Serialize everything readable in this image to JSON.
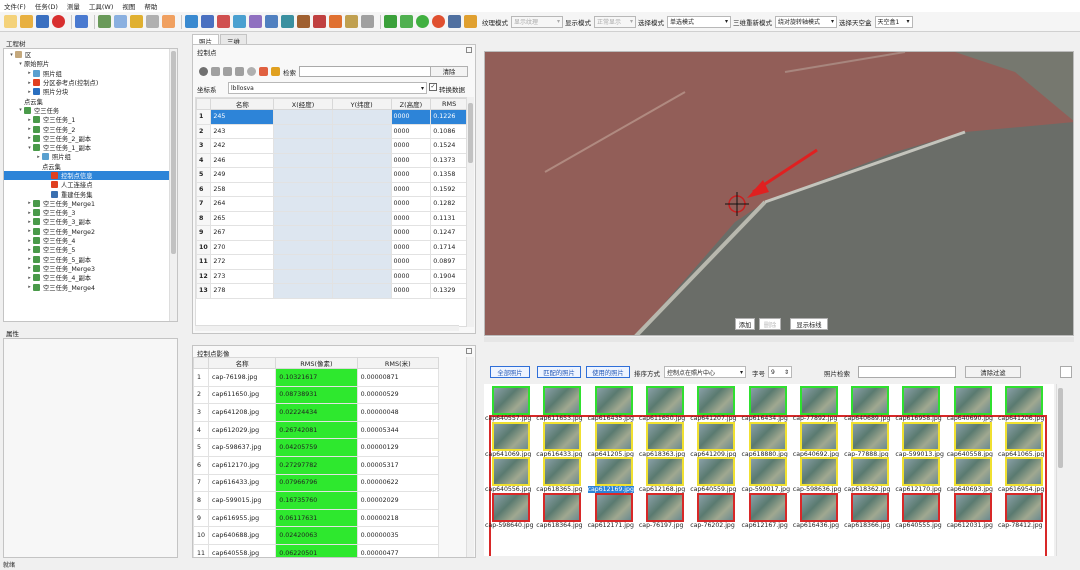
{
  "menu": [
    "文件(F)",
    "任务(D)",
    "测量",
    "工具(W)",
    "视图",
    "帮助"
  ],
  "toolbar": {
    "texture_mode_label": "纹理模式",
    "texture_mode_value": "显示纹理",
    "display_mode_label": "显示模式",
    "display_mode_value": "正常显示",
    "select_mode_label": "选择模式",
    "select_mode_value": "单选模式",
    "roam_mode_label": "三维重新模式",
    "roam_mode_value": "绕对旋转轴模式",
    "sky_label": "选择天空盒",
    "sky_value": "天空盒1"
  },
  "tree": {
    "title": "工程树",
    "scroll_frac": 0.75,
    "items": [
      {
        "label": "区",
        "level": 0,
        "arrow": "▾",
        "color": "#c4a87c",
        "sel": false
      },
      {
        "label": "原始照片",
        "level": 1,
        "arrow": "▾",
        "color": "",
        "sel": false
      },
      {
        "label": "照片组",
        "level": 2,
        "arrow": "▸",
        "color": "#5aa0d0",
        "sel": false
      },
      {
        "label": "分区参考点(控制点)",
        "level": 2,
        "arrow": "▸",
        "color": "#e04020",
        "sel": false
      },
      {
        "label": "照片分块",
        "level": 2,
        "arrow": "▸",
        "color": "#2a6fc0",
        "sel": false
      },
      {
        "label": "点云集",
        "level": 1,
        "arrow": "",
        "color": "",
        "sel": false
      },
      {
        "label": "空三任务",
        "level": 1,
        "arrow": "▾",
        "color": "#4a9a4a",
        "sel": false
      },
      {
        "label": "空三任务_1",
        "level": 2,
        "arrow": "▸",
        "color": "#4a9a4a",
        "sel": false
      },
      {
        "label": "空三任务_2",
        "level": 2,
        "arrow": "▸",
        "color": "#4a9a4a",
        "sel": false
      },
      {
        "label": "空三任务_2_副本",
        "level": 2,
        "arrow": "▸",
        "color": "#4a9a4a",
        "sel": false
      },
      {
        "label": "空三任务_1_副本",
        "level": 2,
        "arrow": "▾",
        "color": "#4a9a4a",
        "sel": false
      },
      {
        "label": "照片组",
        "level": 3,
        "arrow": "▸",
        "color": "#5aa0d0",
        "sel": false
      },
      {
        "label": "点云集",
        "level": 3,
        "arrow": "",
        "color": "",
        "sel": false
      },
      {
        "label": "控制点信息",
        "level": 4,
        "arrow": "",
        "color": "#e04020",
        "sel": true
      },
      {
        "label": "人工连接点",
        "level": 4,
        "arrow": "",
        "color": "#e04020",
        "sel": false
      },
      {
        "label": "重建任务集",
        "level": 4,
        "arrow": "",
        "color": "#3a70b0",
        "sel": false
      },
      {
        "label": "空三任务_Merge1",
        "level": 2,
        "arrow": "▸",
        "color": "#4a9a4a",
        "sel": false
      },
      {
        "label": "空三任务_3",
        "level": 2,
        "arrow": "▸",
        "color": "#4a9a4a",
        "sel": false
      },
      {
        "label": "空三任务_3_副本",
        "level": 2,
        "arrow": "▸",
        "color": "#4a9a4a",
        "sel": false
      },
      {
        "label": "空三任务_Merge2",
        "level": 2,
        "arrow": "▸",
        "color": "#4a9a4a",
        "sel": false
      },
      {
        "label": "空三任务_4",
        "level": 2,
        "arrow": "▸",
        "color": "#4a9a4a",
        "sel": false
      },
      {
        "label": "空三任务_5",
        "level": 2,
        "arrow": "▸",
        "color": "#4a9a4a",
        "sel": false
      },
      {
        "label": "空三任务_5_副本",
        "level": 2,
        "arrow": "▸",
        "color": "#4a9a4a",
        "sel": false
      },
      {
        "label": "空三任务_Merge3",
        "level": 2,
        "arrow": "▸",
        "color": "#4a9a4a",
        "sel": false
      },
      {
        "label": "空三任务_4_副本",
        "level": 2,
        "arrow": "▸",
        "color": "#4a9a4a",
        "sel": false
      },
      {
        "label": "空三任务_Merge4",
        "level": 2,
        "arrow": "▸",
        "color": "#4a9a4a",
        "sel": false
      }
    ]
  },
  "properties_title": "属性",
  "status_text": "就绪",
  "tabs": [
    "照片",
    "三维"
  ],
  "cp": {
    "title": "控制点",
    "search_label": "检索",
    "search_value": "",
    "clear_label": "清除",
    "crs_label": "坐标系",
    "crs_value": "lbllosva",
    "convert_label": "转换数据",
    "headers": [
      "",
      "名称",
      "X(经度)",
      "Y(纬度)",
      "Z(高度)",
      "RMS"
    ],
    "rows": [
      [
        "1",
        "245",
        "0000",
        "0.1226"
      ],
      [
        "2",
        "243",
        "0000",
        "0.1086"
      ],
      [
        "3",
        "242",
        "0000",
        "0.1524"
      ],
      [
        "4",
        "246",
        "0000",
        "0.1373"
      ],
      [
        "5",
        "249",
        "0000",
        "0.1358"
      ],
      [
        "6",
        "258",
        "0000",
        "0.1592"
      ],
      [
        "7",
        "264",
        "0000",
        "0.1282"
      ],
      [
        "8",
        "265",
        "0000",
        "0.1131"
      ],
      [
        "9",
        "267",
        "0000",
        "0.1247"
      ],
      [
        "10",
        "270",
        "0000",
        "0.1714"
      ],
      [
        "11",
        "272",
        "0000",
        "0.0897"
      ],
      [
        "12",
        "273",
        "0000",
        "0.1904"
      ],
      [
        "13",
        "278",
        "0000",
        "0.1329"
      ]
    ]
  },
  "img": {
    "title": "控制点影像",
    "headers": [
      "",
      "名称",
      "RMS(像素)",
      "RMS(米)"
    ],
    "rows": [
      [
        "1",
        "cap-76198.jpg",
        "0.10321617",
        "0.00000871"
      ],
      [
        "2",
        "cap611650.jpg",
        "0.08738931",
        "0.00000529"
      ],
      [
        "3",
        "cap641208.jpg",
        "0.02224434",
        "0.00000048"
      ],
      [
        "4",
        "cap612029.jpg",
        "0.26742081",
        "0.00005344"
      ],
      [
        "5",
        "cap-598637.jpg",
        "0.04205759",
        "0.00000129"
      ],
      [
        "6",
        "cap612170.jpg",
        "0.27297782",
        "0.00005317"
      ],
      [
        "7",
        "cap616433.jpg",
        "0.07966796",
        "0.00000622"
      ],
      [
        "8",
        "cap-599015.jpg",
        "0.16735760",
        "0.00002029"
      ],
      [
        "9",
        "cap616955.jpg",
        "0.06117631",
        "0.00000218"
      ],
      [
        "10",
        "cap640688.jpg",
        "0.02420063",
        "0.00000035"
      ],
      [
        "11",
        "cap640558.jpg",
        "0.06220501",
        "0.00000477"
      ]
    ]
  },
  "viewer": {
    "add_label": "添加",
    "delete_label": "删除",
    "show_line_label": "显示标线"
  },
  "photos": {
    "all": "全部照片",
    "matched": "匹配的照片",
    "used": "使用的照片",
    "sort_label": "排序方式",
    "sort_value": "控制点在照片中心",
    "font_label": "字号",
    "font_value": "9",
    "search_label": "照片检索",
    "search_value": "",
    "clear_filter": "清除过滤",
    "selected": "cap612169.jpg",
    "rows": [
      {
        "color": "g",
        "names": [
          "cap640557.jpg",
          "cap611653.jpg",
          "cap616435.jpg",
          "cap611650.jpg",
          "cap641207.jpg",
          "cap616434.jpg",
          "cap-77892.jpg",
          "cap640689.jpg",
          "cap616958.jpg",
          "cap640690.jpg",
          "cap641206.jpg"
        ]
      },
      {
        "color": "y",
        "names": [
          "cap641069.jpg",
          "cap616433.jpg",
          "cap641205.jpg",
          "cap618363.jpg",
          "cap641209.jpg",
          "cap618880.jpg",
          "cap640692.jpg",
          "cap-77888.jpg",
          "cap-599013.jpg",
          "cap640558.jpg",
          "cap641065.jpg"
        ]
      },
      {
        "color": "y",
        "names": [
          "cap640556.jpg",
          "cap618365.jpg",
          "cap612169.jpg",
          "cap612168.jpg",
          "cap640559.jpg",
          "cap-599017.jpg",
          "cap-598636.jpg",
          "cap618362.jpg",
          "cap612170.jpg",
          "cap640693.jpg",
          "cap616954.jpg"
        ]
      },
      {
        "color": "r",
        "names": [
          "cap-598640.jpg",
          "cap618364.jpg",
          "cap612171.jpg",
          "cap-76197.jpg",
          "cap-76202.jpg",
          "cap612167.jpg",
          "cap616436.jpg",
          "cap618366.jpg",
          "cap640555.jpg",
          "cap612031.jpg",
          "cap-78412.jpg"
        ]
      }
    ]
  }
}
